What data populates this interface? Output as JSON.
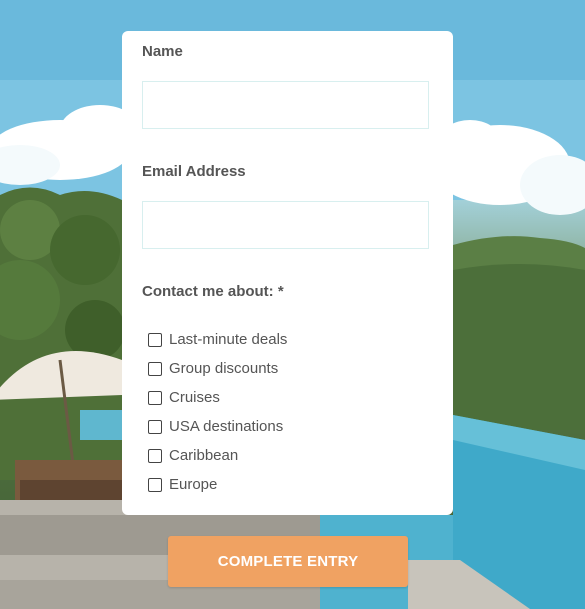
{
  "form": {
    "name_label": "Name",
    "name_value": "",
    "email_label": "Email Address",
    "email_value": "",
    "contact_label": "Contact me about: *",
    "options": [
      {
        "label": "Last-minute deals",
        "checked": false
      },
      {
        "label": "Group discounts",
        "checked": false
      },
      {
        "label": "Cruises",
        "checked": false
      },
      {
        "label": "USA destinations",
        "checked": false
      },
      {
        "label": "Caribbean",
        "checked": false
      },
      {
        "label": "Europe",
        "checked": false
      }
    ],
    "submit_label": "COMPLETE ENTRY"
  },
  "colors": {
    "button": "#f0a262",
    "card": "#ffffff",
    "label_text": "#555555",
    "input_border": "#d8efef"
  }
}
